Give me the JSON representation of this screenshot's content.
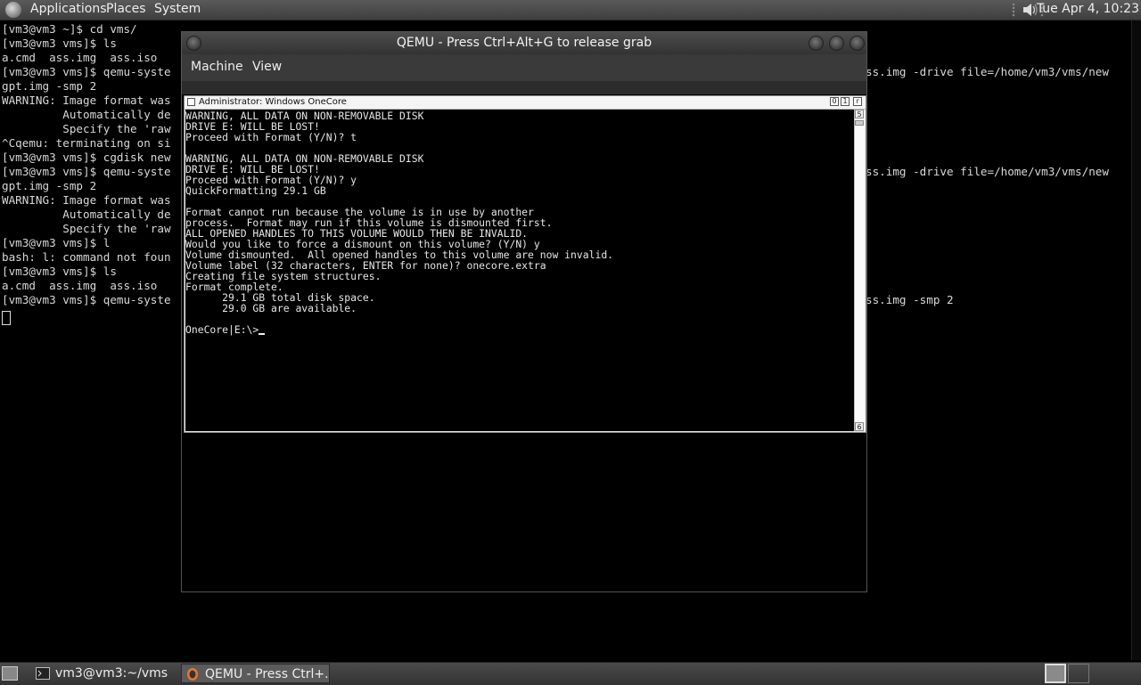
{
  "top_panel": {
    "menus": [
      "Applications",
      "Places",
      "System"
    ],
    "clock": "Tue Apr  4, 10:23"
  },
  "terminal": {
    "lines": [
      "[vm3@vm3 ~]$ cd vms/",
      "[vm3@vm3 vms]$ ls",
      "a.cmd  ass.img  ass.iso",
      "[vm3@vm3 vms]$ qemu-syste",
      "gpt.img -smp 2",
      "WARNING: Image format was",
      "         Automatically de",
      "         Specify the 'raw",
      "^Cqemu: terminating on si",
      "[vm3@vm3 vms]$ cgdisk new",
      "[vm3@vm3 vms]$ qemu-syste",
      "gpt.img -smp 2",
      "WARNING: Image format was",
      "         Automatically de",
      "         Specify the 'raw",
      "[vm3@vm3 vms]$ l",
      "bash: l: command not foun",
      "[vm3@vm3 vms]$ ls",
      "a.cmd  ass.img  ass.iso",
      "[vm3@vm3 vms]$ qemu-syste"
    ],
    "right_fragments": [
      {
        "row": 3,
        "text": "ss.img -drive file=/home/vm3/vms/new"
      },
      {
        "row": 10,
        "text": "ss.img -drive file=/home/vm3/vms/new"
      },
      {
        "row": 19,
        "text": "ss.img -smp 2"
      }
    ]
  },
  "qemu": {
    "title": "QEMU - Press Ctrl+Alt+G to release grab",
    "menu": [
      "Machine",
      "View"
    ],
    "guest": {
      "title": "Administrator: Windows OneCore",
      "console_lines": [
        "WARNING, ALL DATA ON NON-REMOVABLE DISK",
        "DRIVE E: WILL BE LOST!",
        "Proceed with Format (Y/N)? t",
        "",
        "WARNING, ALL DATA ON NON-REMOVABLE DISK",
        "DRIVE E: WILL BE LOST!",
        "Proceed with Format (Y/N)? y",
        "QuickFormatting 29.1 GB",
        "",
        "Format cannot run because the volume is in use by another",
        "process.  Format may run if this volume is dismounted first.",
        "ALL OPENED HANDLES TO THIS VOLUME WOULD THEN BE INVALID.",
        "Would you like to force a dismount on this volume? (Y/N) y",
        "Volume dismounted.  All opened handles to this volume are now invalid.",
        "Volume label (32 characters, ENTER for none)? onecore.extra",
        "Creating file system structures.",
        "Format complete.",
        "      29.1 GB total disk space.",
        "      29.0 GB are available.",
        "",
        "OneCore|E:\\>"
      ]
    }
  },
  "taskbar": {
    "tasks": [
      {
        "label": "vm3@vm3:~/vms"
      },
      {
        "label": "QEMU - Press Ctrl+..."
      }
    ]
  }
}
